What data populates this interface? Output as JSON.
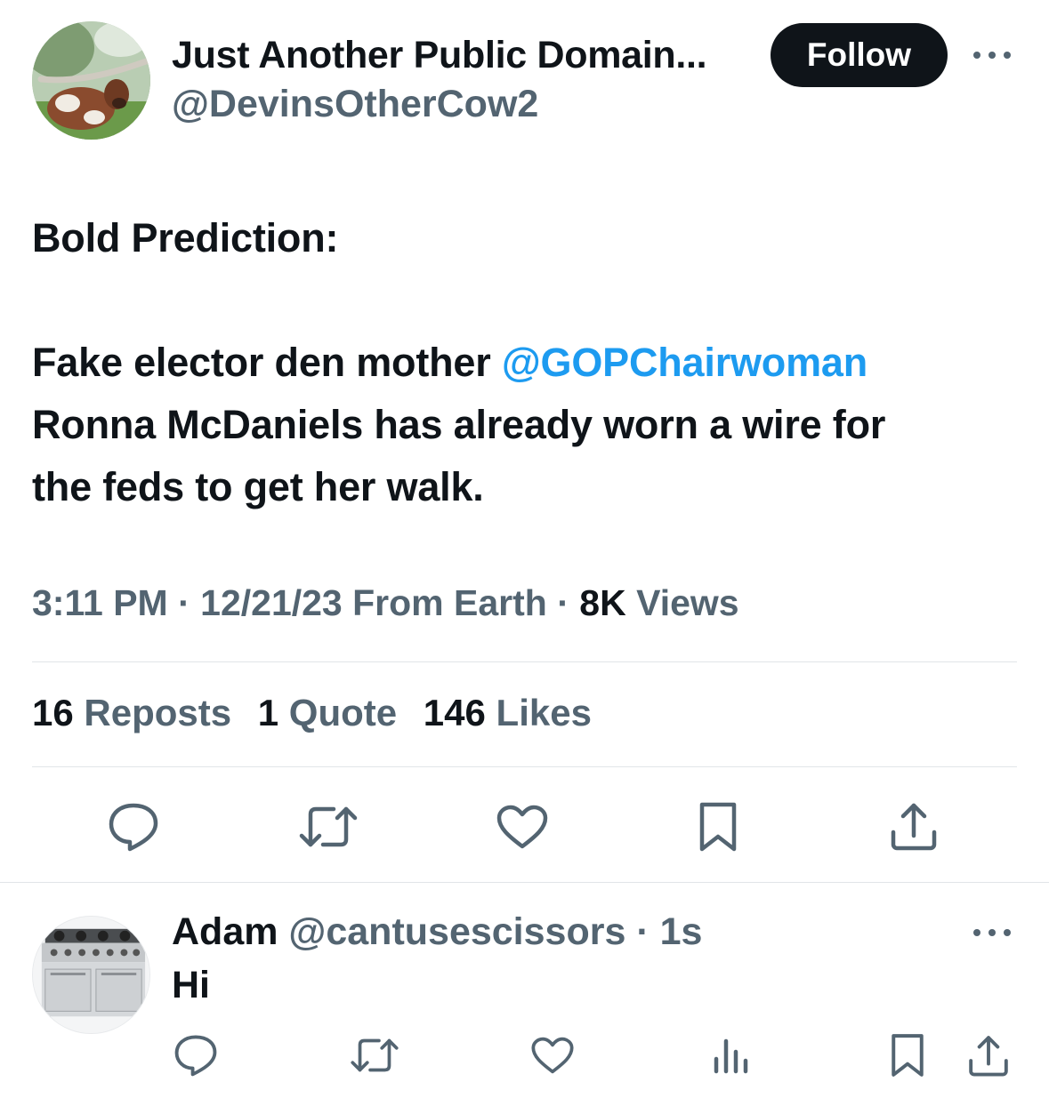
{
  "tweet": {
    "author_name": "Just Another Public Domain...",
    "author_handle": "@DevinsOtherCow2",
    "follow_label": "Follow",
    "text": {
      "line1": "Bold Prediction:",
      "line2_pre": "Fake elector den mother ",
      "line2_mention": "@GOPChairwoman",
      "line3": "Ronna McDaniels has already worn a wire for",
      "line4": "the feds to get her walk."
    },
    "meta": {
      "time": "3:11 PM",
      "sep1": " · ",
      "date": "12/21/23",
      "source": " From Earth",
      "sep2": " · ",
      "views_count": "8K",
      "views_label": " Views"
    },
    "stats": {
      "reposts_count": "16",
      "reposts_label": " Reposts",
      "quotes_count": "1",
      "quotes_label": " Quote",
      "likes_count": "146",
      "likes_label": " Likes"
    }
  },
  "reply": {
    "author_name": "Adam",
    "author_handle": " @cantusescissors",
    "time": " · 1s",
    "text": "Hi"
  },
  "colors": {
    "text": "#0f1419",
    "secondary": "#536471",
    "mention": "#1d9bf0",
    "follow_bg": "#0f1419"
  },
  "icons": [
    "more-icon",
    "reply-icon",
    "repost-icon",
    "like-icon",
    "bookmark-icon",
    "share-icon",
    "views-icon"
  ]
}
